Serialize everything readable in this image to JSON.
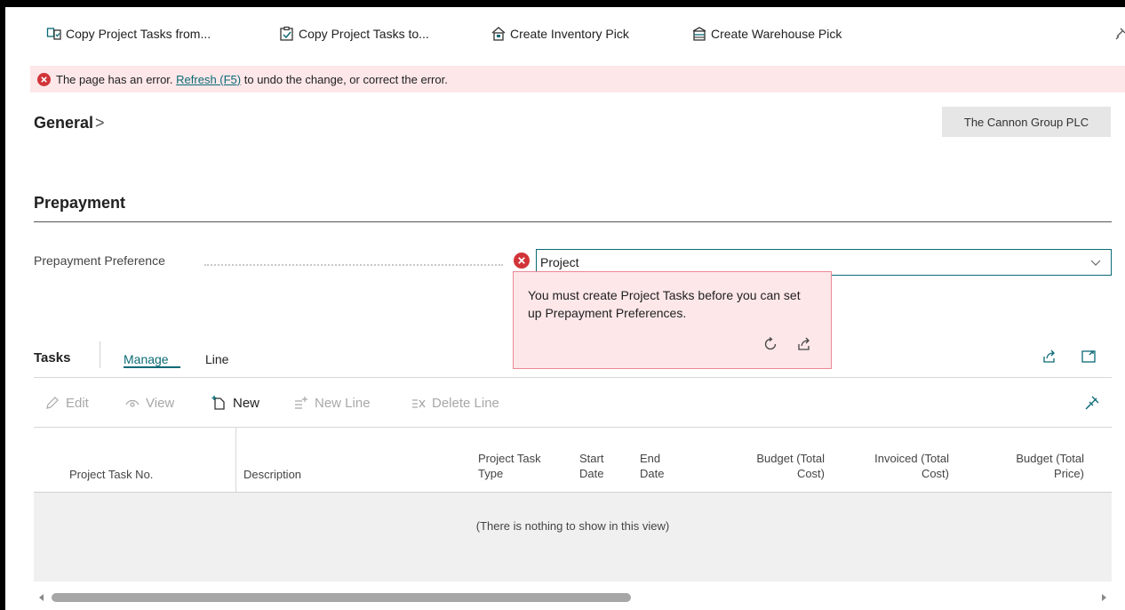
{
  "actions": {
    "copy_from": "Copy Project Tasks from...",
    "copy_to": "Copy Project Tasks to...",
    "inventory_pick": "Create Inventory Pick",
    "warehouse_pick": "Create Warehouse Pick"
  },
  "error_bar": {
    "prefix": "The page has an error.",
    "link": "Refresh (F5)",
    "suffix": "to undo the change, or correct the error."
  },
  "general": {
    "title": "General",
    "chevron": ">"
  },
  "company_badge": "The Cannon Group PLC",
  "prepayment": {
    "title": "Prepayment",
    "field_label": "Prepayment Preference",
    "field_value": "Project",
    "error_message": "You must create Project Tasks before you can set up Prepayment Preferences."
  },
  "tasks": {
    "title": "Tasks",
    "tabs": [
      "Manage",
      "Line"
    ],
    "toolbar": {
      "edit": "Edit",
      "view": "View",
      "new": "New",
      "new_line": "New Line",
      "delete_line": "Delete Line"
    },
    "columns": {
      "task_no": "Project Task No.",
      "description": "Description",
      "type_1": "Project Task",
      "type_2": "Type",
      "start_1": "Start",
      "start_2": "Date",
      "end_1": "End",
      "end_2": "Date",
      "bcost_1": "Budget (Total",
      "bcost_2": "Cost)",
      "icost_1": "Invoiced (Total",
      "icost_2": "Cost)",
      "bprice_1": "Budget (Total",
      "bprice_2": "Price)"
    },
    "empty_message": "(There is nothing to show in this view)"
  },
  "colors": {
    "accent": "#0b6a76",
    "error_bg": "#fde7e9",
    "error_red": "#d13438"
  },
  "icons": [
    "copy-from-icon",
    "copy-to-icon",
    "inventory-pick-icon",
    "warehouse-pick-icon",
    "error-icon",
    "chevron-down-icon",
    "refresh-icon",
    "share-icon",
    "expand-icon",
    "pin-icon",
    "edit-icon",
    "view-icon",
    "new-icon",
    "new-line-icon",
    "delete-line-icon"
  ]
}
